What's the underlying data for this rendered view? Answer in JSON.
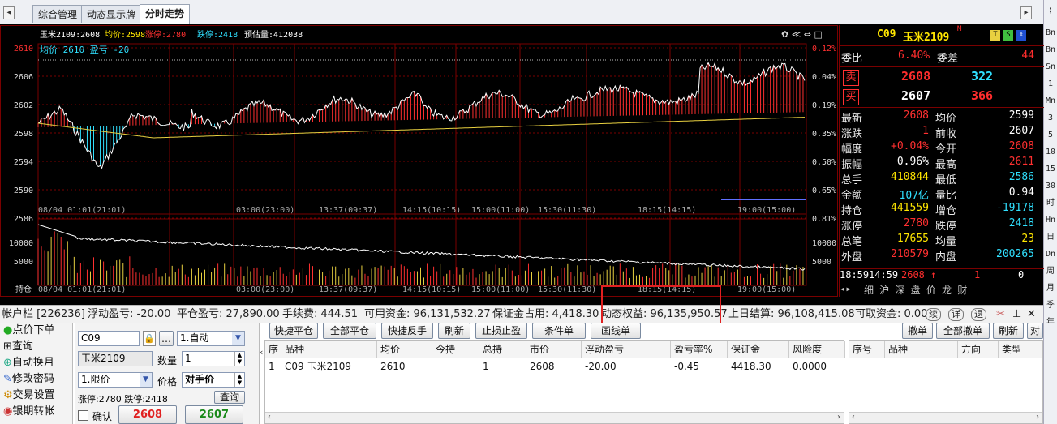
{
  "tabs": [
    "综合管理",
    "动态显示牌",
    "分时走势"
  ],
  "right_toolbar": [
    "Bn",
    "Bn",
    "Sn",
    "1",
    "Mn",
    "3",
    "5",
    "10",
    "15",
    "30",
    "时",
    "Hn",
    "日",
    "Dn",
    "周",
    "月",
    "季",
    "年"
  ],
  "chart": {
    "info_bar": {
      "contract": "玉米2109:2608",
      "avg": "均价:2598",
      "limit_up": "涨停:2780",
      "limit_down": "跌停:2418",
      "est_volume": "预估量:412038"
    },
    "avg_line_label": "均价 2610 盈亏 -20",
    "y_left": [
      "2610",
      "2606",
      "2602",
      "2598",
      "2594",
      "2590",
      "2586"
    ],
    "y_right": [
      "0.12%",
      "0.04%",
      "0.19%",
      "0.35%",
      "0.50%",
      "0.65%",
      "0.81%"
    ],
    "x_labels": [
      "08/04 01:01(21:01)",
      "03:00(23:00)",
      "13:37(09:37)",
      "14:15(10:15)",
      "15:00(11:00)",
      "15:30(11:30)",
      "18:15(14:15)",
      "19:00(15:00)"
    ],
    "vol_left": [
      "10000",
      "5000"
    ],
    "vol_right": [
      "10000",
      "5000"
    ],
    "vol_label": "持仓",
    "colors": {
      "up": "#ff3030",
      "down": "#30e0ff",
      "avg": "#e8d040",
      "grid": "#7a0000"
    }
  },
  "quote": {
    "code": "C09",
    "name": "玉米2109",
    "superscript": "M",
    "icons": [
      "T",
      "S",
      "up-down-icon"
    ],
    "weibi_label": "委比",
    "weibi": "6.40%",
    "weicha_label": "委差",
    "weicha": "44",
    "sell_label": "卖",
    "sell_price": "2608",
    "sell_vol": "322",
    "buy_label": "买",
    "buy_price": "2607",
    "buy_vol": "366",
    "rows": [
      {
        "l1": "最新",
        "v1": "2608",
        "l2": "均价",
        "v2": "2599"
      },
      {
        "l1": "涨跌",
        "v1": "1",
        "l2": "前收",
        "v2": "2607"
      },
      {
        "l1": "幅度",
        "v1": "+0.04%",
        "l2": "今开",
        "v2": "2608"
      },
      {
        "l1": "振幅",
        "v1": "0.96%",
        "l2": "最高",
        "v2": "2611"
      },
      {
        "l1": "总手",
        "v1": "410844",
        "l2": "最低",
        "v2": "2586"
      },
      {
        "l1": "金额",
        "v1": "107亿",
        "l2": "量比",
        "v2": "0.94"
      },
      {
        "l1": "持仓",
        "v1": "441559",
        "l2": "增仓",
        "v2": "-19178"
      },
      {
        "l1": "涨停",
        "v1": "2780",
        "l2": "跌停",
        "v2": "2418"
      },
      {
        "l1": "总笔",
        "v1": "17655",
        "l2": "均量",
        "v2": "23"
      },
      {
        "l1": "外盘",
        "v1": "210579",
        "l2": "内盘",
        "v2": "200265"
      }
    ],
    "tick_time": "18:59",
    "tick_time2": "14:59",
    "tick_price": "2608",
    "tick_arrow": "↑",
    "tick_vol": "1",
    "tick_vol2": "0",
    "tabs_line": "细 沪 深 盘 价 龙 财"
  },
  "status": {
    "account": "帐户栏 [226236]",
    "float_pnl": "浮动盈亏: -20.00",
    "close_pnl": "平仓盈亏: 27,890.00",
    "fee": "手续费: 444.51",
    "available": "可用资金: 96,131,532.27",
    "margin": "保证金占用: 4,418.30",
    "dyn_equity": "动态权益: 96,135,950.57",
    "prev_settle": "上日结算: 96,108,415.08",
    "withdraw": "可取资金: 0.00",
    "btn_bank": "续",
    "btn_detail": "详",
    "btn_exit": "退"
  },
  "nav": [
    "点价下单",
    "查询",
    "自动换月",
    "修改密码",
    "交易设置",
    "银期转帐"
  ],
  "order_form": {
    "code": "C09",
    "name": "玉米2109",
    "mode": "1.自动",
    "qty_label": "数量",
    "qty": "1",
    "price_type": "1.限价",
    "price_label": "价格",
    "price": "对手价",
    "limits": "涨停:2780 跌停:2418",
    "query_btn": "查询",
    "confirm_label": "确认",
    "sell_price": "2608",
    "buy_price": "2607"
  },
  "actions": [
    "快捷平仓",
    "全部平仓",
    "快捷反手",
    "刷新",
    "止损止盈",
    "条件单",
    "画线单"
  ],
  "positions": {
    "headers": [
      "序",
      "品种",
      "均价",
      "今持",
      "总持",
      "市价",
      "浮动盈亏",
      "盈亏率%",
      "保证金",
      "风险度"
    ],
    "rows": [
      [
        "1",
        "C09 玉米2109",
        "2610",
        "",
        "1",
        "2608",
        "-20.00",
        "-0.45",
        "4418.30",
        "0.0000"
      ]
    ]
  },
  "orders": {
    "buttons": [
      "撤单",
      "全部撤单",
      "刷新",
      "对"
    ],
    "headers": [
      "序号",
      "品种",
      "方向",
      "类型"
    ]
  }
}
